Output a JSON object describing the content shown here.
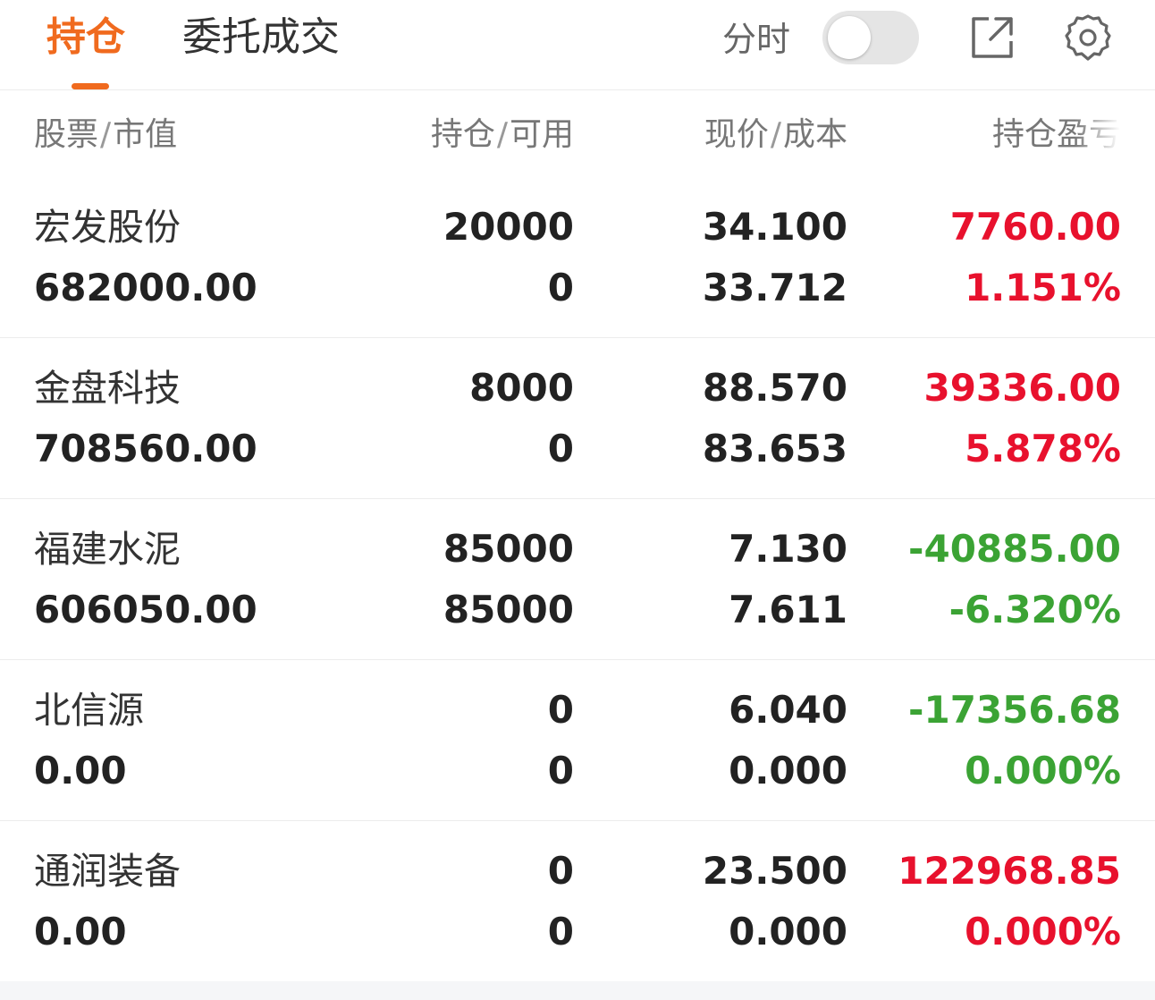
{
  "tabs": {
    "active": "持仓",
    "inactive": "委托成交"
  },
  "toolbar": {
    "fenshi_label": "分时",
    "fenshi_toggle_on": false
  },
  "columns": {
    "stock": "股票",
    "market_value": "市值",
    "position": "持仓",
    "available": "可用",
    "current_price": "现价",
    "cost": "成本",
    "profit_loss": "持仓盈亏",
    "separator": "/"
  },
  "colors": {
    "accent": "#f06a1e",
    "gain": "#e8112d",
    "loss": "#3ba334"
  },
  "holdings": [
    {
      "name": "宏发股份",
      "market_value": "682000.00",
      "position": "20000",
      "available": "0",
      "price": "34.100",
      "cost": "33.712",
      "pl": "7760.00",
      "pl_pct": "1.151%",
      "trend": "up"
    },
    {
      "name": "金盘科技",
      "market_value": "708560.00",
      "position": "8000",
      "available": "0",
      "price": "88.570",
      "cost": "83.653",
      "pl": "39336.00",
      "pl_pct": "5.878%",
      "trend": "up"
    },
    {
      "name": "福建水泥",
      "market_value": "606050.00",
      "position": "85000",
      "available": "85000",
      "price": "7.130",
      "cost": "7.611",
      "pl": "-40885.00",
      "pl_pct": "-6.320%",
      "trend": "down"
    },
    {
      "name": "北信源",
      "market_value": "0.00",
      "position": "0",
      "available": "0",
      "price": "6.040",
      "cost": "0.000",
      "pl": "-17356.68",
      "pl_pct": "0.000%",
      "trend": "down"
    },
    {
      "name": "通润装备",
      "market_value": "0.00",
      "position": "0",
      "available": "0",
      "price": "23.500",
      "cost": "0.000",
      "pl": "122968.85",
      "pl_pct": "0.000%",
      "trend": "up"
    }
  ]
}
